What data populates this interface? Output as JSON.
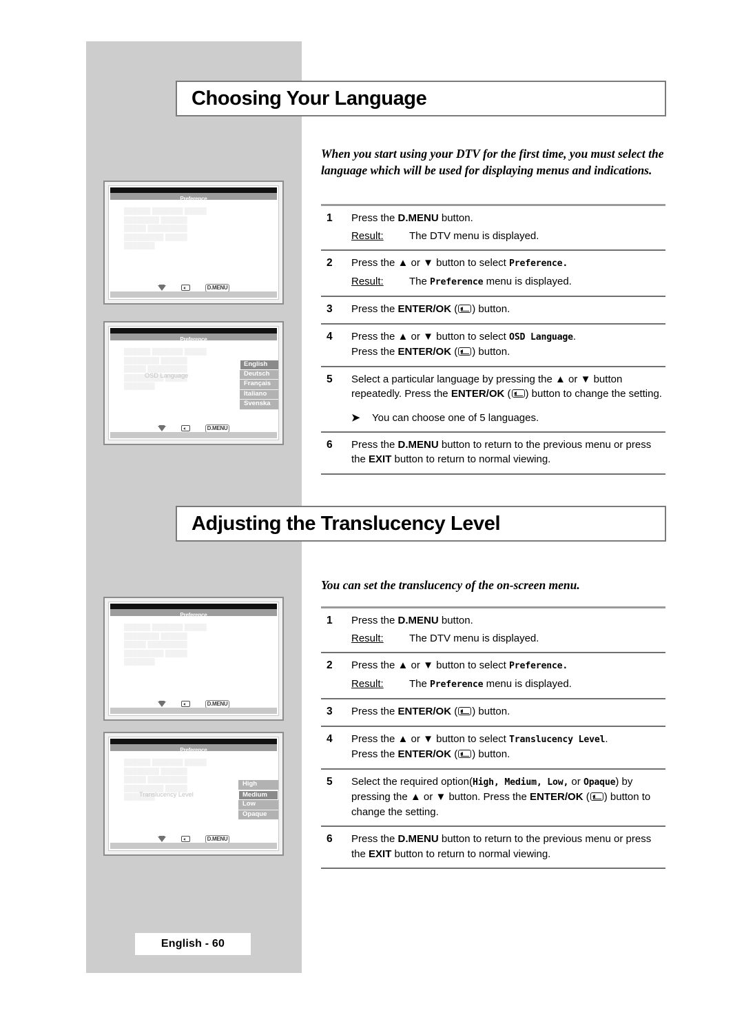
{
  "page": {
    "footer_label": "English - 60",
    "colors": {
      "panel_gray": "#cdcdcd",
      "heading_border": "#7a7a7a",
      "rule_gray": "#9a9a9a",
      "osd_option_bg": "#b2b2b2",
      "osd_option_selected_bg": "#8a8a8a"
    }
  },
  "sections": [
    {
      "heading": "Choosing Your Language",
      "intro": "When you start using your DTV for the first time, you must select the language which will be used for displaying menus and indications.",
      "steps": [
        {
          "num": "1",
          "text_parts": [
            {
              "t": "Press the ",
              "s": "n"
            },
            {
              "t": "D.MENU",
              "s": "b"
            },
            {
              "t": " button.",
              "s": "n"
            }
          ],
          "result_label": "Result:",
          "result_parts": [
            {
              "t": "The DTV menu is displayed.",
              "s": "n"
            }
          ]
        },
        {
          "num": "2",
          "text_parts": [
            {
              "t": "Press the ",
              "s": "n"
            },
            {
              "t": "▲",
              "s": "n"
            },
            {
              "t": " or ",
              "s": "n"
            },
            {
              "t": "▼",
              "s": "n"
            },
            {
              "t": " button to select ",
              "s": "n"
            },
            {
              "t": "Preference.",
              "s": "m"
            }
          ],
          "result_label": "Result:",
          "result_parts": [
            {
              "t": "The ",
              "s": "n"
            },
            {
              "t": "Preference",
              "s": "m"
            },
            {
              "t": " menu is displayed.",
              "s": "n"
            }
          ]
        },
        {
          "num": "3",
          "text_parts": [
            {
              "t": "Press the ",
              "s": "n"
            },
            {
              "t": "ENTER/OK",
              "s": "b"
            },
            {
              "t": " (",
              "s": "n"
            },
            {
              "t": "ok-glyph",
              "s": "icon"
            },
            {
              "t": ") button.",
              "s": "n"
            }
          ]
        },
        {
          "num": "4",
          "text_parts": [
            {
              "t": "Press the ",
              "s": "n"
            },
            {
              "t": "▲",
              "s": "n"
            },
            {
              "t": " or ",
              "s": "n"
            },
            {
              "t": "▼",
              "s": "n"
            },
            {
              "t": " button to select ",
              "s": "n"
            },
            {
              "t": "OSD Language",
              "s": "m"
            },
            {
              "t": ".",
              "s": "n"
            },
            {
              "t": "br",
              "s": "br"
            },
            {
              "t": "Press the ",
              "s": "n"
            },
            {
              "t": "ENTER/OK",
              "s": "b"
            },
            {
              "t": " (",
              "s": "n"
            },
            {
              "t": "ok-glyph",
              "s": "icon"
            },
            {
              "t": ") button.",
              "s": "n"
            }
          ]
        },
        {
          "num": "5",
          "text_parts": [
            {
              "t": "Select a particular language by pressing the ",
              "s": "n"
            },
            {
              "t": "▲",
              "s": "n"
            },
            {
              "t": " or ",
              "s": "n"
            },
            {
              "t": "▼",
              "s": "n"
            },
            {
              "t": " button repeatedly. Press the ",
              "s": "n"
            },
            {
              "t": "ENTER/OK",
              "s": "b"
            },
            {
              "t": " (",
              "s": "n"
            },
            {
              "t": "ok-glyph",
              "s": "icon"
            },
            {
              "t": ") button to change the setting.",
              "s": "n"
            }
          ],
          "note": "You can choose one of 5 languages."
        },
        {
          "num": "6",
          "text_parts": [
            {
              "t": "Press the ",
              "s": "n"
            },
            {
              "t": "D.MENU",
              "s": "b"
            },
            {
              "t": " button to return to the previous menu or press the ",
              "s": "n"
            },
            {
              "t": "EXIT",
              "s": "b"
            },
            {
              "t": " button to return to normal viewing.",
              "s": "n"
            }
          ]
        }
      ]
    },
    {
      "heading": "Adjusting the Translucency Level",
      "intro": "You can set the translucency of the on-screen menu.",
      "steps": [
        {
          "num": "1",
          "text_parts": [
            {
              "t": "Press the ",
              "s": "n"
            },
            {
              "t": "D.MENU",
              "s": "b"
            },
            {
              "t": " button.",
              "s": "n"
            }
          ],
          "result_label": "Result:",
          "result_parts": [
            {
              "t": "The DTV menu is displayed.",
              "s": "n"
            }
          ]
        },
        {
          "num": "2",
          "text_parts": [
            {
              "t": "Press the ",
              "s": "n"
            },
            {
              "t": "▲",
              "s": "n"
            },
            {
              "t": " or ",
              "s": "n"
            },
            {
              "t": "▼",
              "s": "n"
            },
            {
              "t": " button to select ",
              "s": "n"
            },
            {
              "t": "Preference.",
              "s": "m"
            }
          ],
          "result_label": "Result:",
          "result_parts": [
            {
              "t": "The ",
              "s": "n"
            },
            {
              "t": "Preference",
              "s": "m"
            },
            {
              "t": " menu is displayed.",
              "s": "n"
            }
          ]
        },
        {
          "num": "3",
          "text_parts": [
            {
              "t": "Press the ",
              "s": "n"
            },
            {
              "t": "ENTER/OK",
              "s": "b"
            },
            {
              "t": " (",
              "s": "n"
            },
            {
              "t": "ok-glyph",
              "s": "icon"
            },
            {
              "t": ") button.",
              "s": "n"
            }
          ]
        },
        {
          "num": "4",
          "text_parts": [
            {
              "t": "Press the ",
              "s": "n"
            },
            {
              "t": "▲",
              "s": "n"
            },
            {
              "t": " or ",
              "s": "n"
            },
            {
              "t": "▼",
              "s": "n"
            },
            {
              "t": " button to select ",
              "s": "n"
            },
            {
              "t": "Translucency Level",
              "s": "m"
            },
            {
              "t": ".",
              "s": "n"
            },
            {
              "t": "br",
              "s": "br"
            },
            {
              "t": "Press the ",
              "s": "n"
            },
            {
              "t": "ENTER/OK",
              "s": "b"
            },
            {
              "t": " (",
              "s": "n"
            },
            {
              "t": "ok-glyph",
              "s": "icon"
            },
            {
              "t": ") button.",
              "s": "n"
            }
          ]
        },
        {
          "num": "5",
          "text_parts": [
            {
              "t": "Select the required option(",
              "s": "n"
            },
            {
              "t": "High, Medium, Low,",
              "s": "m"
            },
            {
              "t": " or ",
              "s": "n"
            },
            {
              "t": "Opaque",
              "s": "m"
            },
            {
              "t": ") by pressing the ",
              "s": "n"
            },
            {
              "t": "▲",
              "s": "n"
            },
            {
              "t": " or ",
              "s": "n"
            },
            {
              "t": "▼",
              "s": "n"
            },
            {
              "t": " button. Press the ",
              "s": "n"
            },
            {
              "t": "ENTER/OK",
              "s": "b"
            },
            {
              "t": " (",
              "s": "n"
            },
            {
              "t": "ok-glyph",
              "s": "icon"
            },
            {
              "t": ") button to change the setting.",
              "s": "n"
            }
          ]
        },
        {
          "num": "6",
          "text_parts": [
            {
              "t": "Press the ",
              "s": "n"
            },
            {
              "t": "D.MENU",
              "s": "b"
            },
            {
              "t": " button to return to the previous menu or press the ",
              "s": "n"
            },
            {
              "t": "EXIT",
              "s": "b"
            },
            {
              "t": " button to return to normal viewing.",
              "s": "n"
            }
          ]
        }
      ]
    }
  ],
  "screens": [
    {
      "id": "tv-1",
      "title": "Preference",
      "field_label": "",
      "options": [],
      "bottom": {
        "down_icon": "triangle-down-icon",
        "ok_icon": "enter-ok-icon",
        "menu_label": "D.MENU"
      }
    },
    {
      "id": "tv-2",
      "title": "Preference",
      "field_label": "OSD Language",
      "options": [
        "English",
        "Deutsch",
        "Français",
        "Italiano",
        "Svenska"
      ],
      "selected": "English",
      "bottom": {
        "down_icon": "triangle-down-icon",
        "ok_icon": "enter-ok-icon",
        "menu_label": "D.MENU"
      }
    },
    {
      "id": "tv-3",
      "title": "Preference",
      "field_label": "",
      "options": [],
      "bottom": {
        "down_icon": "triangle-down-icon",
        "ok_icon": "enter-ok-icon",
        "menu_label": "D.MENU"
      }
    },
    {
      "id": "tv-4",
      "title": "Preference",
      "field_label": "Translucency Level",
      "options": [
        "High",
        "Medium",
        "Low",
        "Opaque"
      ],
      "selected": "Medium",
      "bottom": {
        "down_icon": "triangle-down-icon",
        "ok_icon": "enter-ok-icon",
        "menu_label": "D.MENU"
      }
    }
  ]
}
